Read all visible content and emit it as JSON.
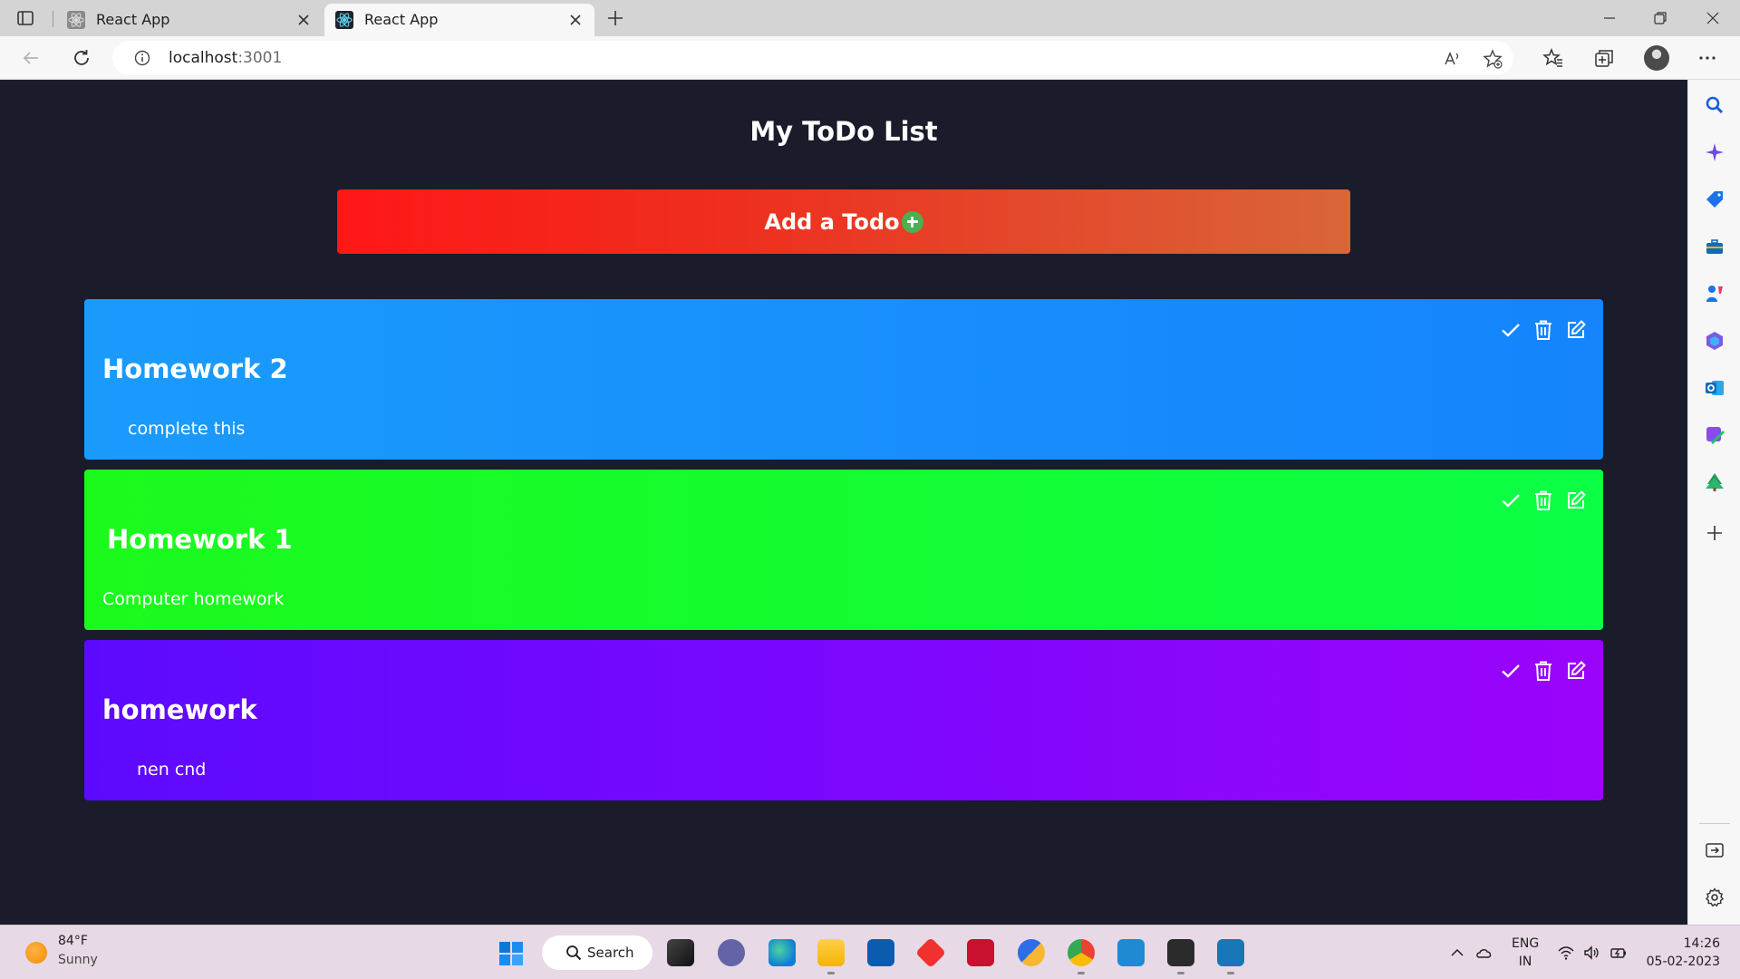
{
  "browser": {
    "tabs": [
      {
        "label": "React App",
        "active": false
      },
      {
        "label": "React App",
        "active": true
      }
    ],
    "address": {
      "host": "localhost",
      "port": ":3001"
    }
  },
  "app": {
    "title": "My ToDo List",
    "add_button_label": "Add a Todo",
    "todos": [
      {
        "title": "Homework 2",
        "description": "complete this",
        "color": "#1a9bfc"
      },
      {
        "title": "Homework 1",
        "description": "Computer homework",
        "color": "#1cfa1c"
      },
      {
        "title": "homework",
        "description": "nen cnd",
        "color": "#5c0aff"
      }
    ]
  },
  "taskbar": {
    "weather": {
      "temp": "84°F",
      "condition": "Sunny"
    },
    "search_label": "Search",
    "language": {
      "line1": "ENG",
      "line2": "IN"
    },
    "clock": {
      "time": "14:26",
      "date": "05-02-2023"
    }
  },
  "colors": {
    "app_background": "#1a1b2b",
    "add_button_start": "#ff1717",
    "add_button_end": "#d9653a",
    "add_icon": "#4caf50",
    "taskbar": "#e8d9e6"
  }
}
